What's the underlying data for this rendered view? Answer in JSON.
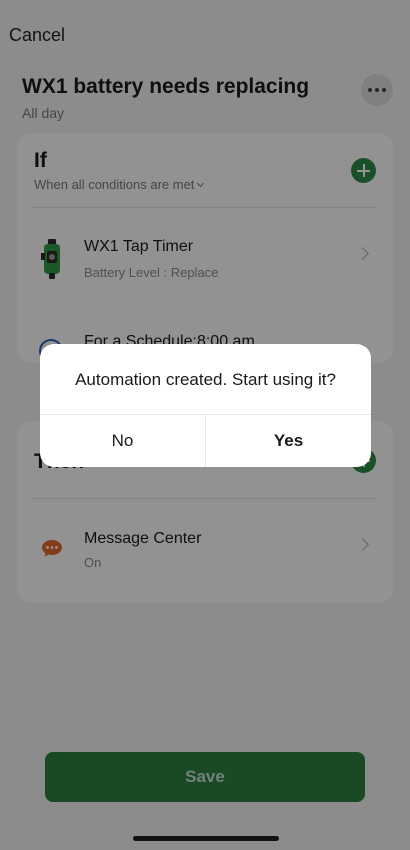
{
  "header": {
    "cancel_label": "Cancel",
    "title": "WX1 battery needs replacing",
    "subtitle": "All day"
  },
  "if_section": {
    "title": "If",
    "condition_mode": "When all conditions are met",
    "items": [
      {
        "title": "WX1 Tap Timer",
        "subtitle": "Battery Level : Replace",
        "icon": "tap-timer-icon"
      },
      {
        "title": "For a Schedule:8:00 am",
        "icon": "schedule-icon"
      }
    ]
  },
  "then_section": {
    "title": "Then",
    "items": [
      {
        "title": "Message Center",
        "subtitle": "On",
        "icon": "message-icon"
      }
    ]
  },
  "dialog": {
    "message": "Automation created. Start using it?",
    "no_label": "No",
    "yes_label": "Yes"
  },
  "footer": {
    "save_label": "Save"
  },
  "colors": {
    "accent_green": "#2d8a46",
    "save_green": "#2c7f41",
    "message_orange": "#e06a2c"
  }
}
